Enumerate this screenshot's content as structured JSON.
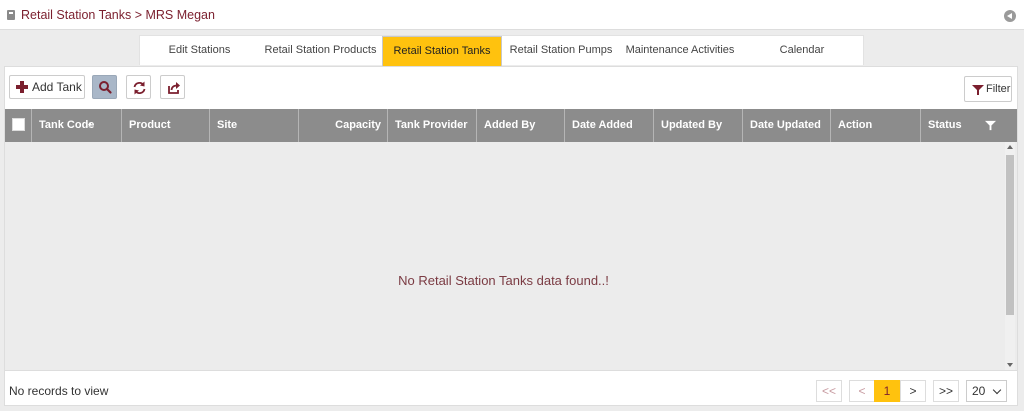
{
  "breadcrumb": "Retail Station Tanks > MRS Megan",
  "tabs": [
    {
      "label": "Edit Stations",
      "active": false
    },
    {
      "label": "Retail Station Products",
      "active": false
    },
    {
      "label": "Retail Station Tanks",
      "active": true
    },
    {
      "label": "Retail Station Pumps",
      "active": false
    },
    {
      "label": "Maintenance Activities",
      "active": false
    },
    {
      "label": "Calendar",
      "active": false
    }
  ],
  "toolbar": {
    "add_label": "Add Tank",
    "filter_label": "Filter"
  },
  "columns": [
    "Tank Code",
    "Product",
    "Site",
    "Capacity",
    "Tank Provider",
    "Added By",
    "Date Added",
    "Updated By",
    "Date Updated",
    "Action",
    "Status"
  ],
  "empty_message": "No Retail Station Tanks data found..!",
  "footer": {
    "records_text": "No records to view",
    "first": "<<",
    "prev": "<",
    "current_page": "1",
    "next": ">",
    "last": ">>",
    "page_size": "20"
  },
  "colors": {
    "accent": "#ffc20e",
    "brand": "#7b1f2e",
    "header_bg": "#8c8c8c"
  }
}
